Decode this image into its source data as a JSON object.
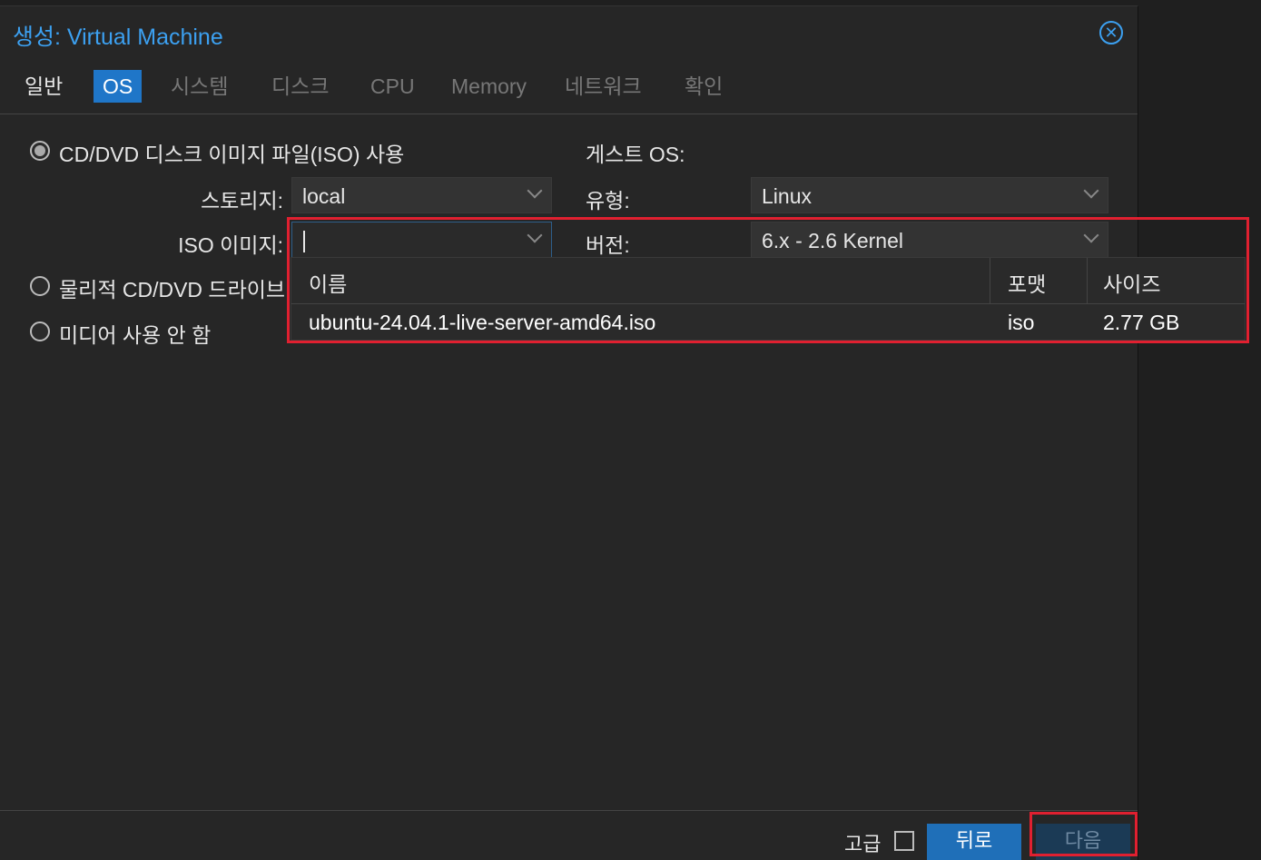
{
  "dialog": {
    "title": "생성: Virtual Machine",
    "close_icon": "close-circle-icon"
  },
  "tabs": [
    {
      "label": "일반"
    },
    {
      "label": "OS"
    },
    {
      "label": "시스템"
    },
    {
      "label": "디스크"
    },
    {
      "label": "CPU"
    },
    {
      "label": "Memory"
    },
    {
      "label": "네트워크"
    },
    {
      "label": "확인"
    }
  ],
  "active_tab": "OS",
  "media": {
    "iso_option_label": "CD/DVD 디스크 이미지 파일(ISO) 사용",
    "iso_selected": true,
    "storage_label": "스토리지:",
    "storage_value": "local",
    "iso_image_label": "ISO 이미지:",
    "iso_image_value": "",
    "physical_option_label": "물리적 CD/DVD 드라이브",
    "none_option_label": "미디어 사용 안 함"
  },
  "guest_os": {
    "heading": "게스트 OS:",
    "type_label": "유형:",
    "type_value": "Linux",
    "version_label": "버전:",
    "version_value": "6.x - 2.6 Kernel"
  },
  "iso_dropdown": {
    "columns": [
      "이름",
      "포맷",
      "사이즈"
    ],
    "rows": [
      {
        "name": "ubuntu-24.04.1-live-server-amd64.iso",
        "format": "iso",
        "size": "2.77 GB"
      }
    ]
  },
  "footer": {
    "advanced_label": "고급",
    "advanced_checked": false,
    "back_label": "뒤로",
    "next_label": "다음"
  },
  "colors": {
    "accent": "#3ca0f0",
    "active_tab": "#1f76c8",
    "highlight_border": "#e02030"
  }
}
